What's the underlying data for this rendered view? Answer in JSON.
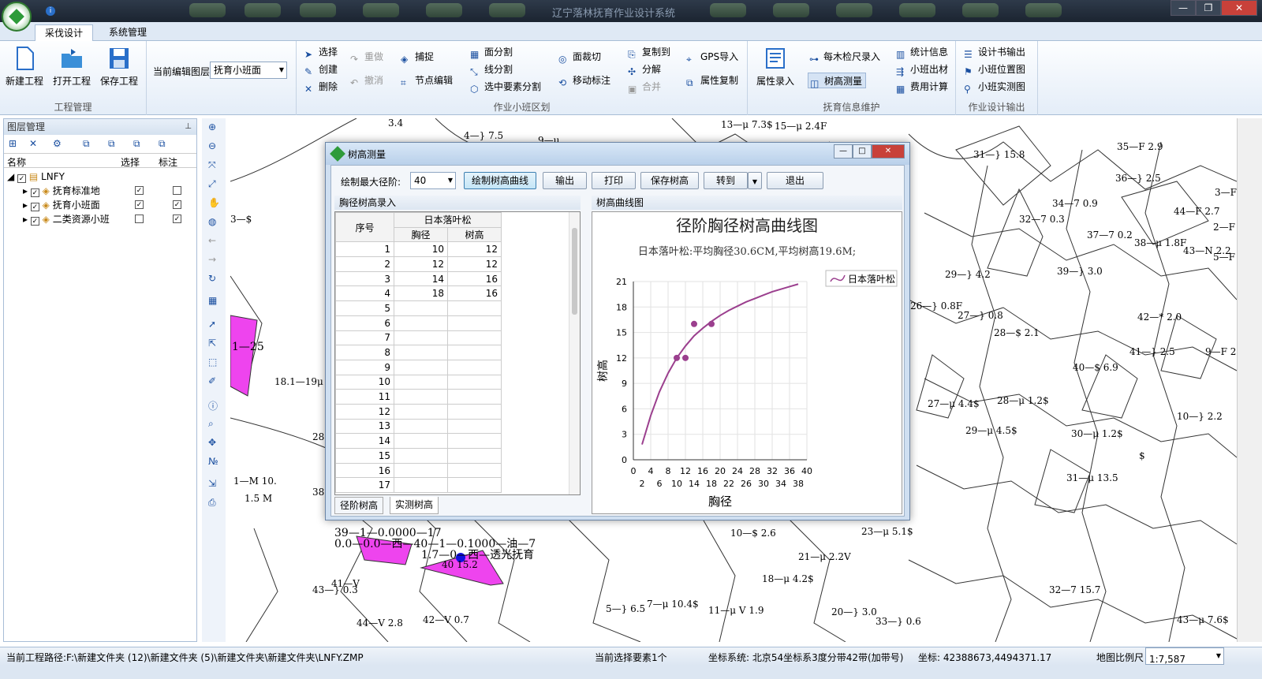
{
  "window": {
    "title": "辽宁落林抚育作业设计系统"
  },
  "tabs": [
    "采伐设计",
    "系统管理"
  ],
  "ribbon": {
    "project": {
      "label": "工程管理",
      "new": "新建工程",
      "open": "打开工程",
      "save": "保存工程"
    },
    "layer": {
      "label": "当前编辑图层",
      "value": "抚育小班面"
    },
    "zone": {
      "label": "作业小班区划",
      "select": "选择",
      "create": "创建",
      "delete": "删除",
      "redo": "重做",
      "undo": "撤消",
      "snap": "捕捉",
      "node_edit": "节点编辑",
      "face_split": "面分割",
      "line_split": "线分割",
      "selected_split": "选中要素分割",
      "face_clip": "面裁切",
      "move_label": "移动标注",
      "copy_to": "复制到",
      "explode": "分解",
      "merge": "合并",
      "gps_import": "GPS导入",
      "attr_copy": "属性复制"
    },
    "maintain": {
      "label": "抚育信息维护",
      "attr_entry": "属性录入",
      "tally": "每木检尺录入",
      "tree_height": "树高测量",
      "stats": "统计信息",
      "timber": "小班出材",
      "cost": "费用计算"
    },
    "output": {
      "label": "作业设计输出",
      "book": "设计书输出",
      "location": "小班位置图",
      "survey": "小班实测图"
    }
  },
  "layers": {
    "title": "图层管理",
    "cols": {
      "name": "名称",
      "select": "选择",
      "label": "标注"
    },
    "root": "LNFY",
    "items": [
      {
        "name": "抚育标准地",
        "select": true,
        "label": false
      },
      {
        "name": "抚育小班面",
        "select": true,
        "label": true
      },
      {
        "name": "二类资源小班",
        "select": false,
        "label": true
      }
    ]
  },
  "dialog": {
    "title": "树高测量",
    "max_label": "绘制最大径阶:",
    "max_value": "40",
    "buttons": {
      "draw": "绘制树高曲线",
      "output": "输出",
      "print": "打印",
      "save": "保存树高",
      "goto": "转到",
      "exit": "退出"
    },
    "grid_title": "胸径树高录入",
    "chart_title_pane": "树高曲线图",
    "grid_head": {
      "seq": "序号",
      "species": "日本落叶松",
      "dbh": "胸径",
      "height": "树高"
    },
    "rows": [
      {
        "n": "1",
        "d": "10",
        "h": "12"
      },
      {
        "n": "2",
        "d": "12",
        "h": "12"
      },
      {
        "n": "3",
        "d": "14",
        "h": "16"
      },
      {
        "n": "4",
        "d": "18",
        "h": "16"
      },
      {
        "n": "5",
        "d": "",
        "h": ""
      },
      {
        "n": "6",
        "d": "",
        "h": ""
      },
      {
        "n": "7",
        "d": "",
        "h": ""
      },
      {
        "n": "8",
        "d": "",
        "h": ""
      },
      {
        "n": "9",
        "d": "",
        "h": ""
      },
      {
        "n": "10",
        "d": "",
        "h": ""
      },
      {
        "n": "11",
        "d": "",
        "h": ""
      },
      {
        "n": "12",
        "d": "",
        "h": ""
      },
      {
        "n": "13",
        "d": "",
        "h": ""
      },
      {
        "n": "14",
        "d": "",
        "h": ""
      },
      {
        "n": "15",
        "d": "",
        "h": ""
      },
      {
        "n": "16",
        "d": "",
        "h": ""
      },
      {
        "n": "17",
        "d": "",
        "h": ""
      }
    ],
    "bottom_tabs": [
      "径阶树高",
      "实测树高"
    ]
  },
  "chart_data": {
    "type": "scatter",
    "title": "径阶胸径树高曲线图",
    "subtitle": "日本落叶松:平均胸径30.6CM,平均树高19.6M;",
    "xlabel": "胸径",
    "ylabel": "树高",
    "xlim": [
      0,
      40
    ],
    "ylim": [
      0,
      21
    ],
    "x_ticks_top": [
      0,
      4,
      8,
      12,
      16,
      20,
      24,
      28,
      32,
      36,
      40
    ],
    "x_ticks_bottom": [
      2,
      6,
      10,
      14,
      18,
      22,
      26,
      30,
      34,
      38
    ],
    "y_ticks": [
      0,
      3,
      6,
      9,
      12,
      15,
      18,
      21
    ],
    "grid": true,
    "legend": "top-right",
    "points": [
      {
        "x": 10,
        "y": 12
      },
      {
        "x": 12,
        "y": 12
      },
      {
        "x": 14,
        "y": 16
      },
      {
        "x": 18,
        "y": 16
      }
    ],
    "series": [
      {
        "name": "日本落叶松",
        "color": "#9b3f8e",
        "x": [
          2,
          4,
          6,
          8,
          10,
          12,
          14,
          16,
          18,
          20,
          22,
          24,
          26,
          28,
          30,
          32,
          34,
          36,
          38
        ],
        "y": [
          1.8,
          5.2,
          8.0,
          10.2,
          12.0,
          13.4,
          14.6,
          15.5,
          16.3,
          17.0,
          17.6,
          18.1,
          18.6,
          19.0,
          19.4,
          19.8,
          20.1,
          20.4,
          20.7
        ]
      }
    ]
  },
  "map": {
    "labels": [
      "13—μ 7.3$",
      "15—μ 2.4F",
      "4—} 7.5",
      "9—μ",
      "31—} 15.8",
      "35—F 2.9",
      "36—} 2.5",
      "3—F 2.5",
      "34—7 0.9",
      "44—F 2.7",
      "32—7 0.3",
      "37—7 0.2",
      "38—μ 1.8F",
      "43—N 2.2",
      "2—F 0.4",
      "5—F 0.3",
      "39—} 3.0",
      "29—} 4.2",
      "26—} 0.8F",
      "27—} 0.8",
      "42—* 2.0",
      "28—$ 2.1",
      "41—} 2.5",
      "9—F 2.7",
      "40—$ 6.9",
      "27—μ 4.4$",
      "28—μ 1.2$",
      "10—} 2.2",
      "29—μ 4.5$",
      "30—μ 1.2$",
      "31—μ 13.5",
      "18.1—19μ 1.3 M8$",
      "28 5.",
      "1—M 10.",
      "1.5 M",
      "38",
      "39—1—0.0000—17",
      "0.0—0.0—西—40—1—0.1000—油—7",
      "1.7—0—西—透光抚育",
      "40 15.2",
      "43—} 0.3",
      "41—V",
      "44—V 2.8",
      "42—V 0.7",
      "5—} 6.5",
      "7—μ 10.4$",
      "11—μ V 1.9",
      "20—} 3.0",
      "33—} 0.6",
      "10—$ 2.6",
      "23—μ 5.1$",
      "21—μ 2.2V",
      "18—μ 4.2$",
      "32—7 15.7",
      "43—μ 7.6$",
      "3—$",
      "3.4",
      "1—25",
      "$"
    ]
  },
  "status": {
    "path": "当前工程路径:F:\\新建文件夹 (12)\\新建文件夹 (5)\\新建文件夹\\新建文件夹\\LNFY.ZMP",
    "selection": "当前选择要素1个",
    "crs": "坐标系统: 北京54坐标系3度分带42带(加带号)",
    "coords": "坐标: 42388673,4494371.17",
    "scale_label": "地图比例尺",
    "scale_value": "1:7,587"
  }
}
